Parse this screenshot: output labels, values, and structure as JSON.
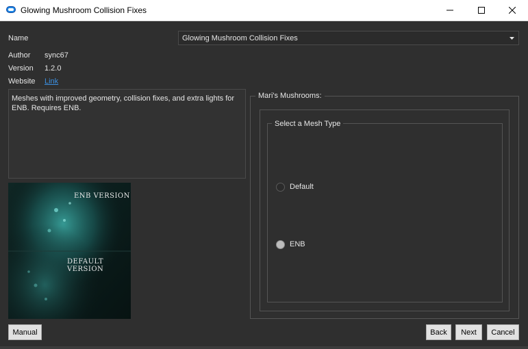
{
  "window": {
    "title": "Glowing Mushroom Collision Fixes",
    "icon": "mod-organizer-icon",
    "controls": [
      "minimize-icon",
      "maximize-icon",
      "close-icon"
    ]
  },
  "info": {
    "name_label": "Name",
    "name_value": "Glowing Mushroom Collision Fixes",
    "author_label": "Author",
    "author_value": "sync67",
    "version_label": "Version",
    "version_value": "1.2.0",
    "website_label": "Website",
    "website_link": "Link"
  },
  "description": "Meshes with improved geometry, collision fixes, and extra lights for ENB. Requires ENB.",
  "preview": {
    "caption_top": "ENB VERSION",
    "caption_bottom": "DEFAULT VERSION"
  },
  "options": {
    "group_title": "Mari's Mushrooms:",
    "subgroup_title": "Select a Mesh Type",
    "items": [
      {
        "label": "Default",
        "selected": false
      },
      {
        "label": "ENB",
        "selected": true
      }
    ]
  },
  "buttons": {
    "manual": "Manual",
    "back": "Back",
    "next": "Next",
    "cancel": "Cancel"
  },
  "colors": {
    "background": "#2f2f2f",
    "link": "#3b8fe0",
    "text": "#e6e6e6"
  }
}
